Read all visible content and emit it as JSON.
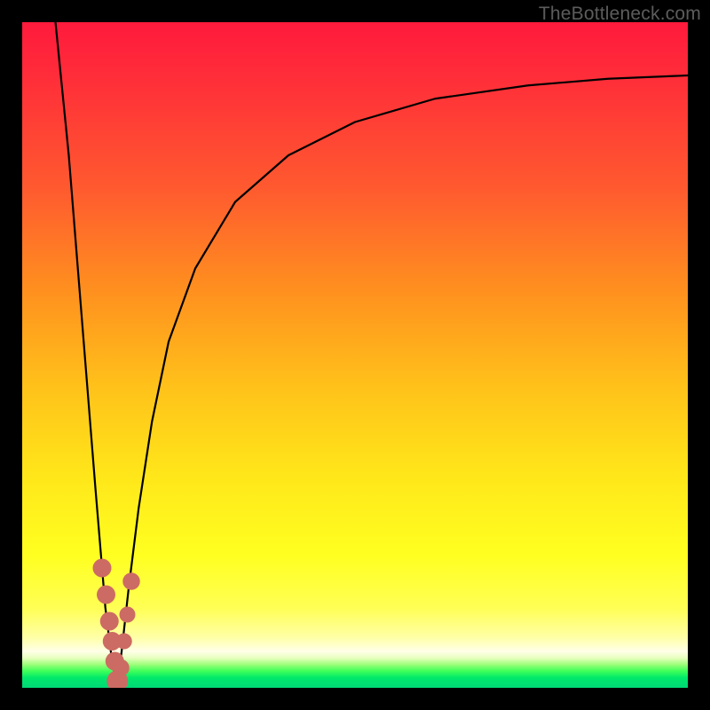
{
  "attribution": "TheBottleneck.com",
  "colors": {
    "frame": "#000000",
    "curve": "#000000",
    "markers": "#cc6b63",
    "gradient_top": "#ff1a3c",
    "gradient_mid": "#ffff20",
    "gradient_bottom": "#00d877"
  },
  "chart_data": {
    "type": "line",
    "title": "",
    "xlabel": "",
    "ylabel": "",
    "xlim": [
      0,
      100
    ],
    "ylim": [
      0,
      100
    ],
    "grid": false,
    "legend": false,
    "series": [
      {
        "name": "left-branch",
        "x": [
          5.0,
          7.0,
          9.0,
          11.0,
          12.5,
          13.5,
          14.3
        ],
        "y": [
          100,
          80,
          55,
          30,
          12,
          4,
          0
        ]
      },
      {
        "name": "right-branch",
        "x": [
          14.3,
          15.0,
          16.0,
          17.5,
          19.5,
          22.0,
          26.0,
          32.0,
          40.0,
          50.0,
          62.0,
          76.0,
          88.0,
          100.0
        ],
        "y": [
          0,
          6,
          15,
          27,
          40,
          52,
          63,
          73,
          80,
          85,
          88.5,
          90.5,
          91.5,
          92
        ]
      }
    ],
    "markers": [
      {
        "x": 12.0,
        "y": 18,
        "r": 1.4
      },
      {
        "x": 12.6,
        "y": 14,
        "r": 1.4
      },
      {
        "x": 13.1,
        "y": 10,
        "r": 1.4
      },
      {
        "x": 13.5,
        "y": 7,
        "r": 1.4
      },
      {
        "x": 13.9,
        "y": 4,
        "r": 1.4
      },
      {
        "x": 14.3,
        "y": 1,
        "r": 1.6
      },
      {
        "x": 14.8,
        "y": 3,
        "r": 1.3
      },
      {
        "x": 15.3,
        "y": 7,
        "r": 1.2
      },
      {
        "x": 15.8,
        "y": 11,
        "r": 1.2
      },
      {
        "x": 16.4,
        "y": 16,
        "r": 1.3
      }
    ]
  }
}
